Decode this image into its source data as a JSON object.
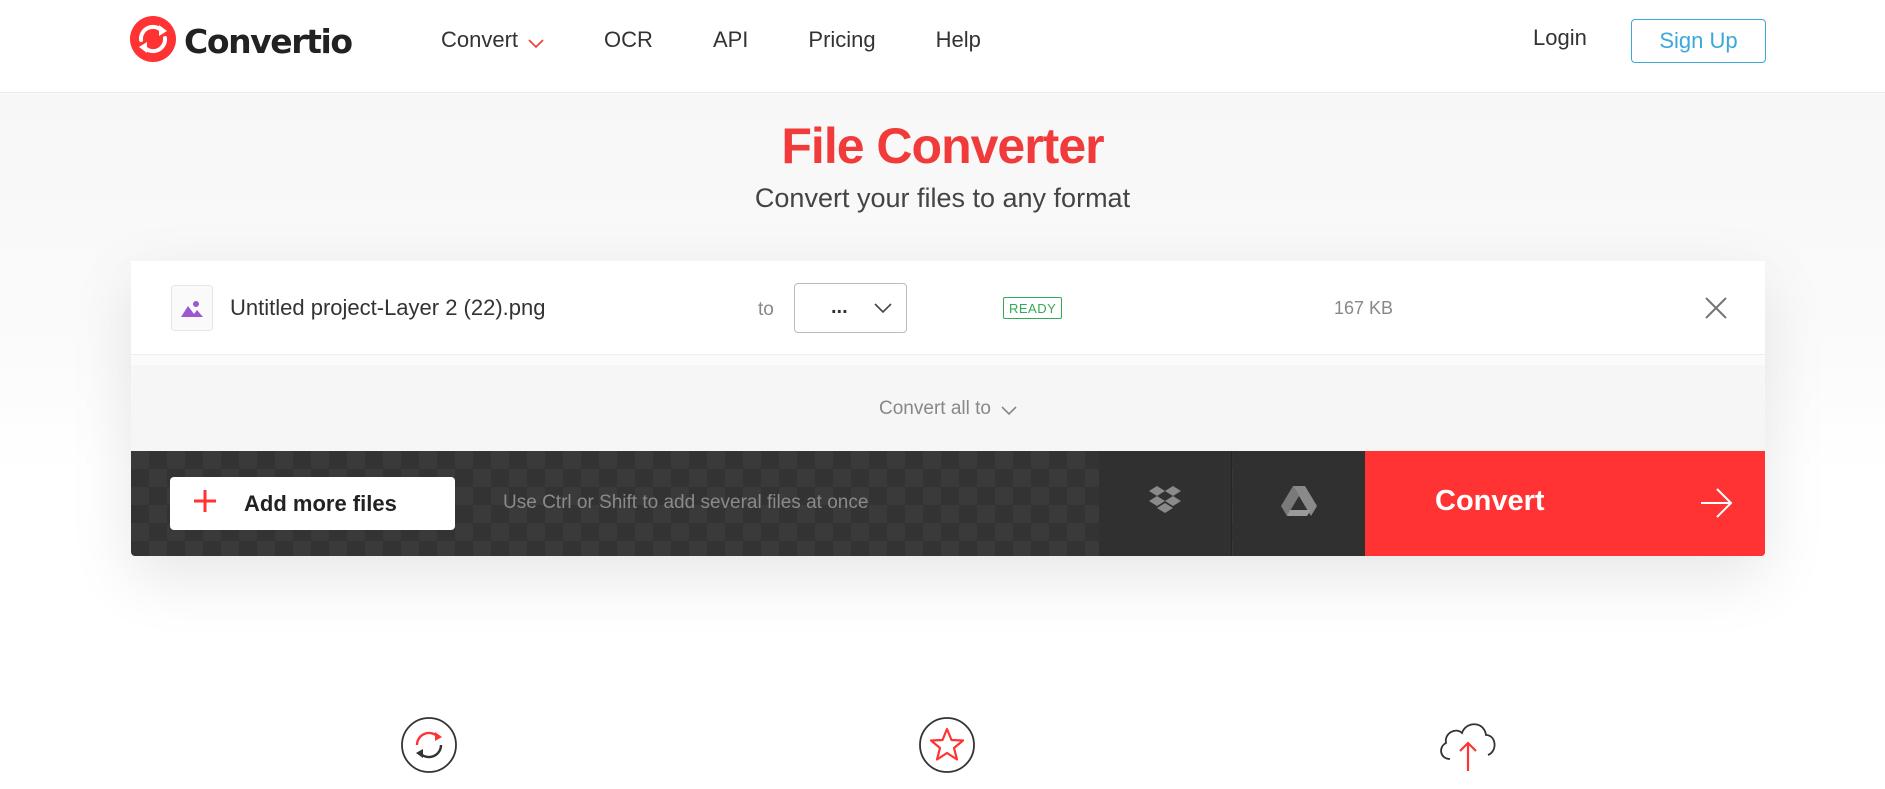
{
  "header": {
    "logo_text": "Convertio",
    "nav": [
      {
        "label": "Convert",
        "has_dropdown": true
      },
      {
        "label": "OCR"
      },
      {
        "label": "API"
      },
      {
        "label": "Pricing"
      },
      {
        "label": "Help"
      }
    ],
    "login_label": "Login",
    "signup_label": "Sign Up"
  },
  "hero": {
    "title": "File Converter",
    "subtitle": "Convert your files to any format"
  },
  "file": {
    "icon": "image-file-icon",
    "name": "Untitled project-Layer 2 (22).png",
    "to_label": "to",
    "format_value": "...",
    "status": "READY",
    "size": "167 KB"
  },
  "convert_all_label": "Convert all to",
  "actions": {
    "add_files_label": "Add more files",
    "hint": "Use Ctrl or Shift to add several files at once",
    "convert_label": "Convert",
    "dropbox_icon": "dropbox-icon",
    "gdrive_icon": "google-drive-icon"
  },
  "features": [
    "refresh-icon",
    "star-icon",
    "cloud-upload-icon"
  ],
  "colors": {
    "brand_red": "#ff3333",
    "title_red": "#f13a3a",
    "signup_blue": "#3aa8d8",
    "ready_green": "#34a853",
    "file_icon_purple": "#9b59d0"
  }
}
